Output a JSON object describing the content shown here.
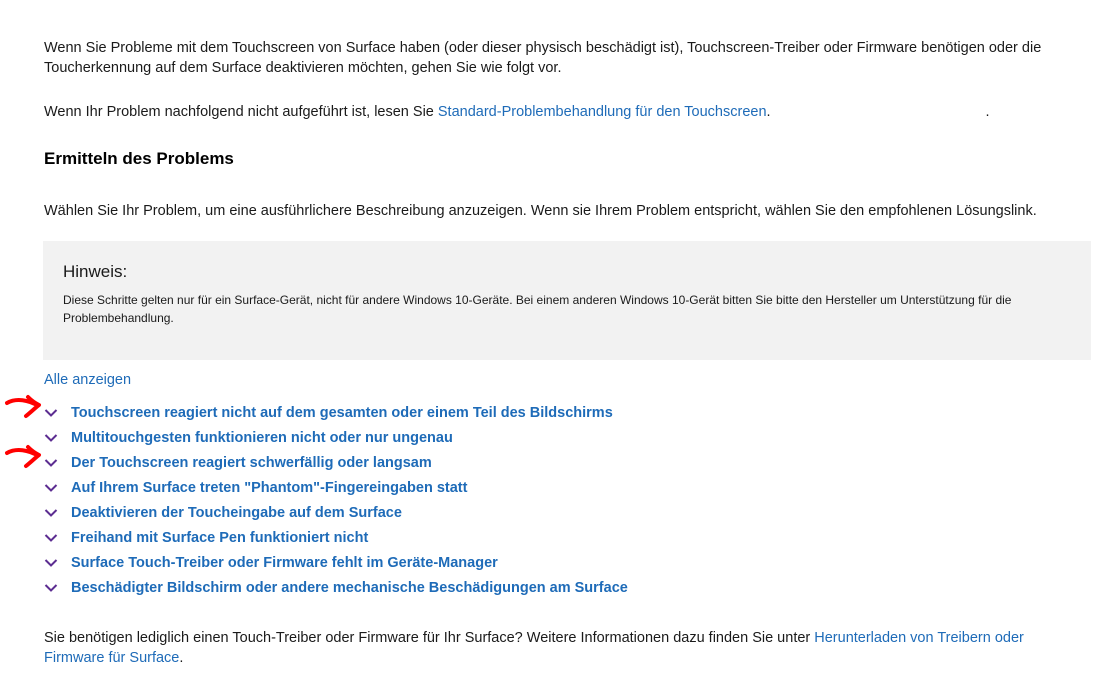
{
  "intro": "Wenn Sie Probleme mit dem Touchscreen von Surface haben (oder dieser physisch beschädigt ist), Touchscreen-Treiber oder Firmware benötigen oder die Toucherkennung auf dem Surface deaktivieren möchten, gehen Sie wie folgt vor.",
  "second": {
    "text": "Wenn Ihr Problem nachfolgend nicht aufgeführt ist, lesen Sie ",
    "link": "Standard-Problembehandlung für den Touchscreen",
    "after": ".",
    "trailing_dot": "."
  },
  "heading": "Ermitteln des Problems",
  "choose": "Wählen Sie Ihr Problem, um eine ausführlichere Beschreibung anzuzeigen. Wenn sie Ihrem Problem entspricht, wählen Sie den empfohlenen Lösungslink.",
  "note": {
    "title": "Hinweis:",
    "body": "Diese Schritte gelten nur für ein Surface-Gerät, nicht für andere Windows 10-Geräte. Bei einem anderen Windows 10-Gerät bitten Sie bitte den Hersteller um Unterstützung für die Problembehandlung."
  },
  "show_all": "Alle anzeigen",
  "accordion": [
    {
      "label": "Touchscreen reagiert nicht auf dem gesamten oder einem Teil des Bildschirms",
      "marked": true
    },
    {
      "label": "Multitouchgesten funktionieren nicht oder nur ungenau",
      "marked": false
    },
    {
      "label": "Der Touchscreen reagiert schwerfällig oder langsam",
      "marked": true
    },
    {
      "label": "Auf Ihrem Surface treten \"Phantom\"-Fingereingaben statt",
      "marked": false
    },
    {
      "label": "Deaktivieren der Toucheingabe auf dem Surface",
      "marked": false
    },
    {
      "label": "Freihand mit Surface Pen funktioniert nicht",
      "marked": false
    },
    {
      "label": "Surface Touch-Treiber oder Firmware fehlt im Geräte-Manager",
      "marked": false
    },
    {
      "label": "Beschädigter Bildschirm oder andere mechanische Beschädigungen am Surface",
      "marked": false
    }
  ],
  "footer": {
    "text": "Sie benötigen lediglich einen Touch-Treiber oder Firmware für Ihr Surface? Weitere Informationen dazu finden Sie unter ",
    "link": "Herunterladen von Treibern oder Firmware für Surface",
    "after": "."
  },
  "colors": {
    "link": "#1e6bb8",
    "chevron": "#5c2d91",
    "note_bg": "#f2f2f2",
    "annotation_arrow": "#ff0000"
  }
}
